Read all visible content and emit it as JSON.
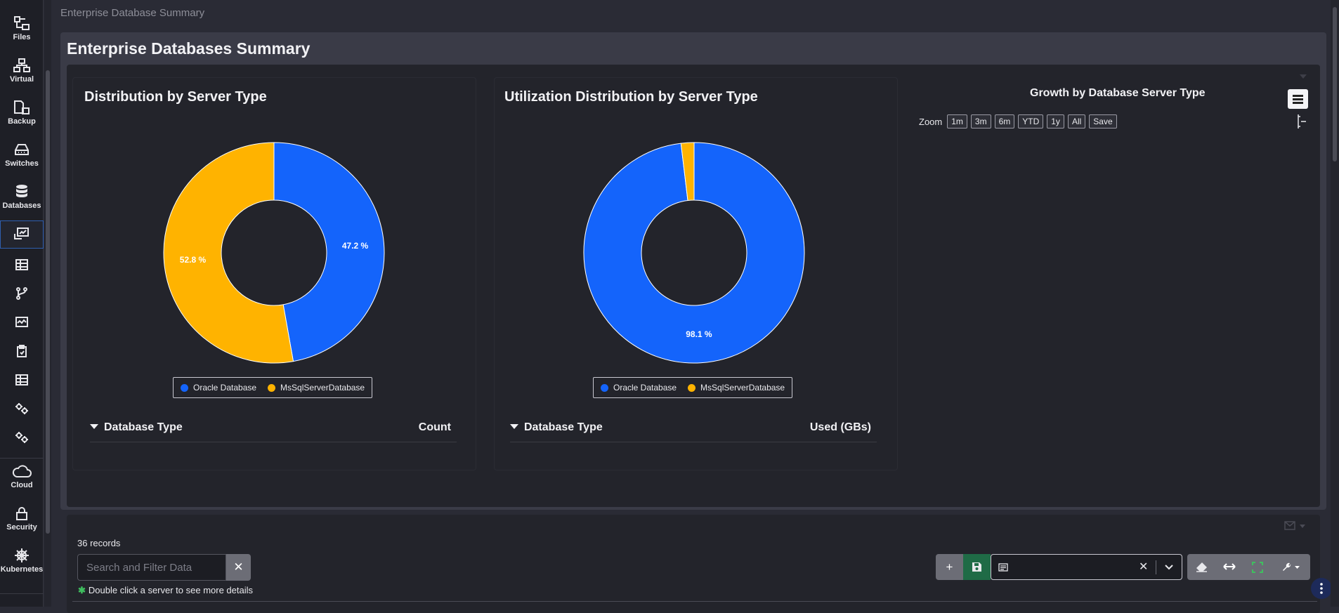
{
  "breadcrumb": "Enterprise Database Summary",
  "page_title": "Enterprise Databases Summary",
  "sidebar": {
    "items": [
      {
        "label": "Files",
        "icon": "files-icon"
      },
      {
        "label": "Virtual",
        "icon": "network-icon"
      },
      {
        "label": "Backup",
        "icon": "backup-icon"
      },
      {
        "label": "Switches",
        "icon": "switch-icon"
      },
      {
        "label": "Databases",
        "icon": "database-icon"
      },
      {
        "label": "Cloud",
        "icon": "cloud-icon"
      },
      {
        "label": "Security",
        "icon": "lock-icon"
      },
      {
        "label": "Kubernetes",
        "icon": "helm-icon"
      }
    ],
    "tool_icons": [
      "dashboard-icon",
      "table-icon",
      "branch-icon",
      "monitor-icon",
      "clipboard-icon",
      "table-icon",
      "gears-icon",
      "gears-icon"
    ]
  },
  "colors": {
    "oracle": "#1464fb",
    "mssql": "#ffb300",
    "accent": "#2f5fb0"
  },
  "chart_data": [
    {
      "type": "pie",
      "title": "Distribution by Server Type",
      "categories": [
        "Oracle Database",
        "MsSqlServerDatabase"
      ],
      "values": [
        47.2,
        52.8
      ],
      "labels": [
        "47.2 %",
        "52.8 %"
      ],
      "legend": "bottom-center"
    },
    {
      "type": "pie",
      "title": "Utilization Distribution by Server Type",
      "categories": [
        "Oracle Database",
        "MsSqlServerDatabase"
      ],
      "values": [
        98.1,
        1.9
      ],
      "labels": [
        "98.1 %",
        ""
      ],
      "legend": "bottom-center"
    }
  ],
  "table1": {
    "col1": "Database Type",
    "col2": "Count"
  },
  "table2": {
    "col1": "Database Type",
    "col2": "Used (GBs)"
  },
  "growth": {
    "title": "Growth by Database Server Type",
    "zoom_label": "Zoom",
    "zoom_buttons": [
      "1m",
      "3m",
      "6m",
      "YTD",
      "1y",
      "All",
      "Save"
    ]
  },
  "grid": {
    "records": "36 records",
    "search_placeholder": "Search and Filter Data",
    "hint": "Double click a server to see more details"
  }
}
